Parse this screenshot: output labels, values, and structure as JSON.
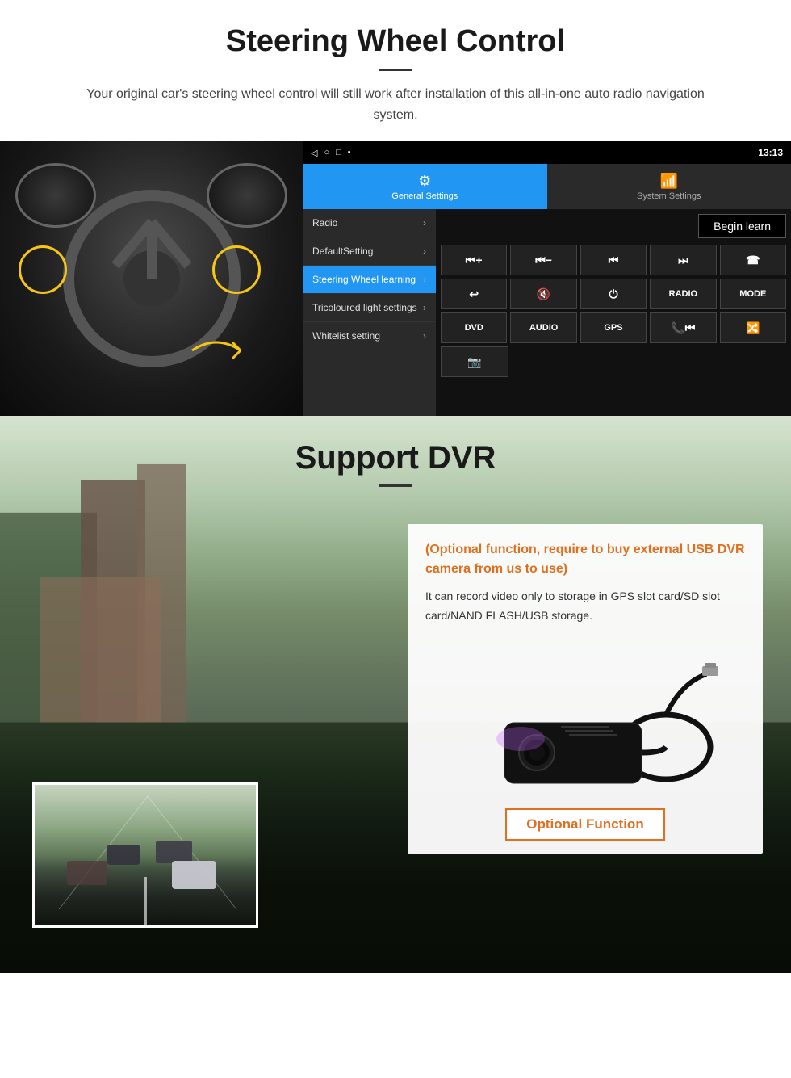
{
  "header": {
    "title": "Steering Wheel Control",
    "subtitle": "Your original car's steering wheel control will still work after installation of this all-in-one auto radio navigation system."
  },
  "android_ui": {
    "statusbar": {
      "time": "13:13",
      "icons": [
        "◁",
        "○",
        "□",
        "▪"
      ]
    },
    "tab_general": "General Settings",
    "tab_system": "System Settings",
    "menu_items": [
      {
        "label": "Radio",
        "active": false
      },
      {
        "label": "DefaultSetting",
        "active": false
      },
      {
        "label": "Steering Wheel learning",
        "active": true
      },
      {
        "label": "Tricoloured light settings",
        "active": false
      },
      {
        "label": "Whitelist setting",
        "active": false
      }
    ],
    "begin_learn_label": "Begin learn",
    "control_buttons_row1": [
      "⏮+",
      "⏮-",
      "⏮⏮",
      "⏭⏭",
      "☎"
    ],
    "control_buttons_row2": [
      "↩",
      "🔇",
      "⏻",
      "RADIO",
      "MODE"
    ],
    "control_buttons_row3": [
      "DVD",
      "AUDIO",
      "GPS",
      "📞⏮",
      "🔀⏭"
    ]
  },
  "dvr_section": {
    "title": "Support DVR",
    "optional_highlight": "(Optional function, require to buy external USB DVR camera from us to use)",
    "description": "It can record video only to storage in GPS slot card/SD slot card/NAND FLASH/USB storage.",
    "optional_button_label": "Optional Function"
  }
}
